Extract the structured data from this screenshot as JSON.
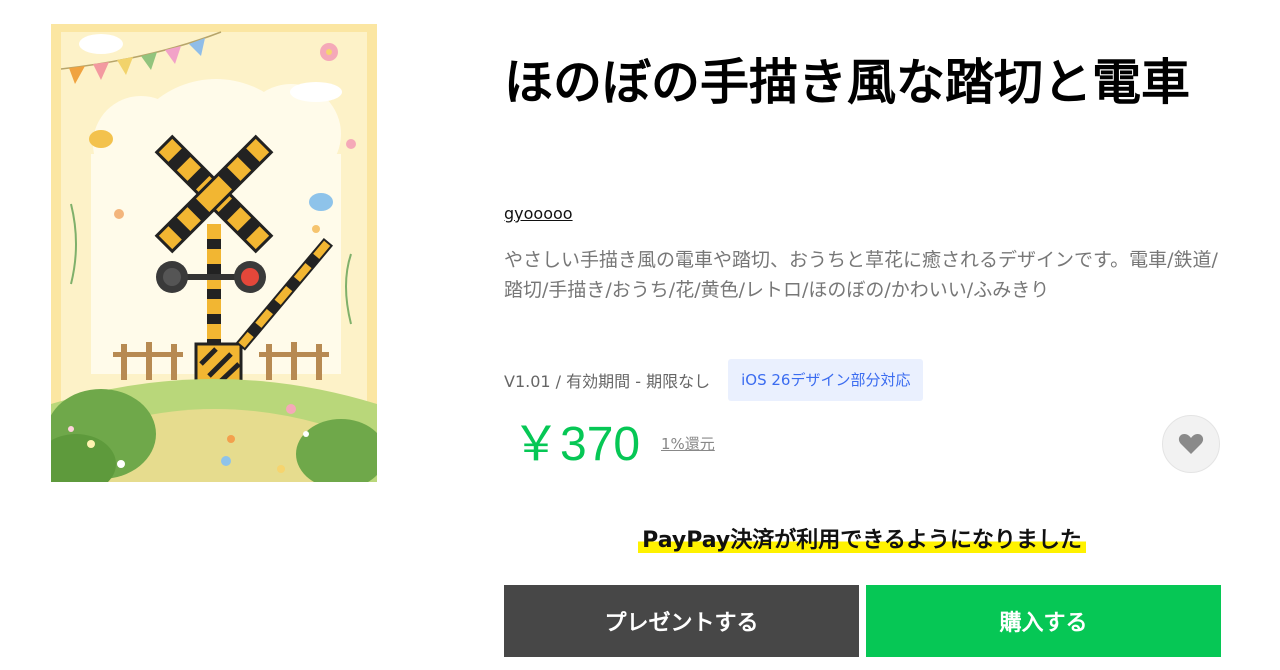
{
  "product": {
    "title": "ほのぼの手描き風な踏切と電車",
    "author": "gyooooo",
    "description": "やさしい手描き風の電車や踏切、おうちと草花に癒されるデザインです。電車/鉄道/踏切/手描き/おうち/花/黄色/レトロ/ほのぼの/かわいい/ふみきり",
    "version_info": "V1.01 / 有効期間 - 期限なし",
    "ios_badge": "iOS 26デザイン部分対応",
    "price": "￥370",
    "cashback": "1%還元",
    "thumbnail_icon": "railroad-crossing-illustration"
  },
  "notice": {
    "paypay": "PayPay決済が利用できるようになりました"
  },
  "actions": {
    "present_label": "プレゼントする",
    "buy_label": "購入する",
    "favorite_icon": "heart-icon"
  },
  "colors": {
    "accent_green": "#06c755",
    "present_gray": "#474747",
    "badge_bg": "#eaf0fe",
    "badge_text": "#3b6cf0",
    "highlight_yellow": "#fff200"
  }
}
